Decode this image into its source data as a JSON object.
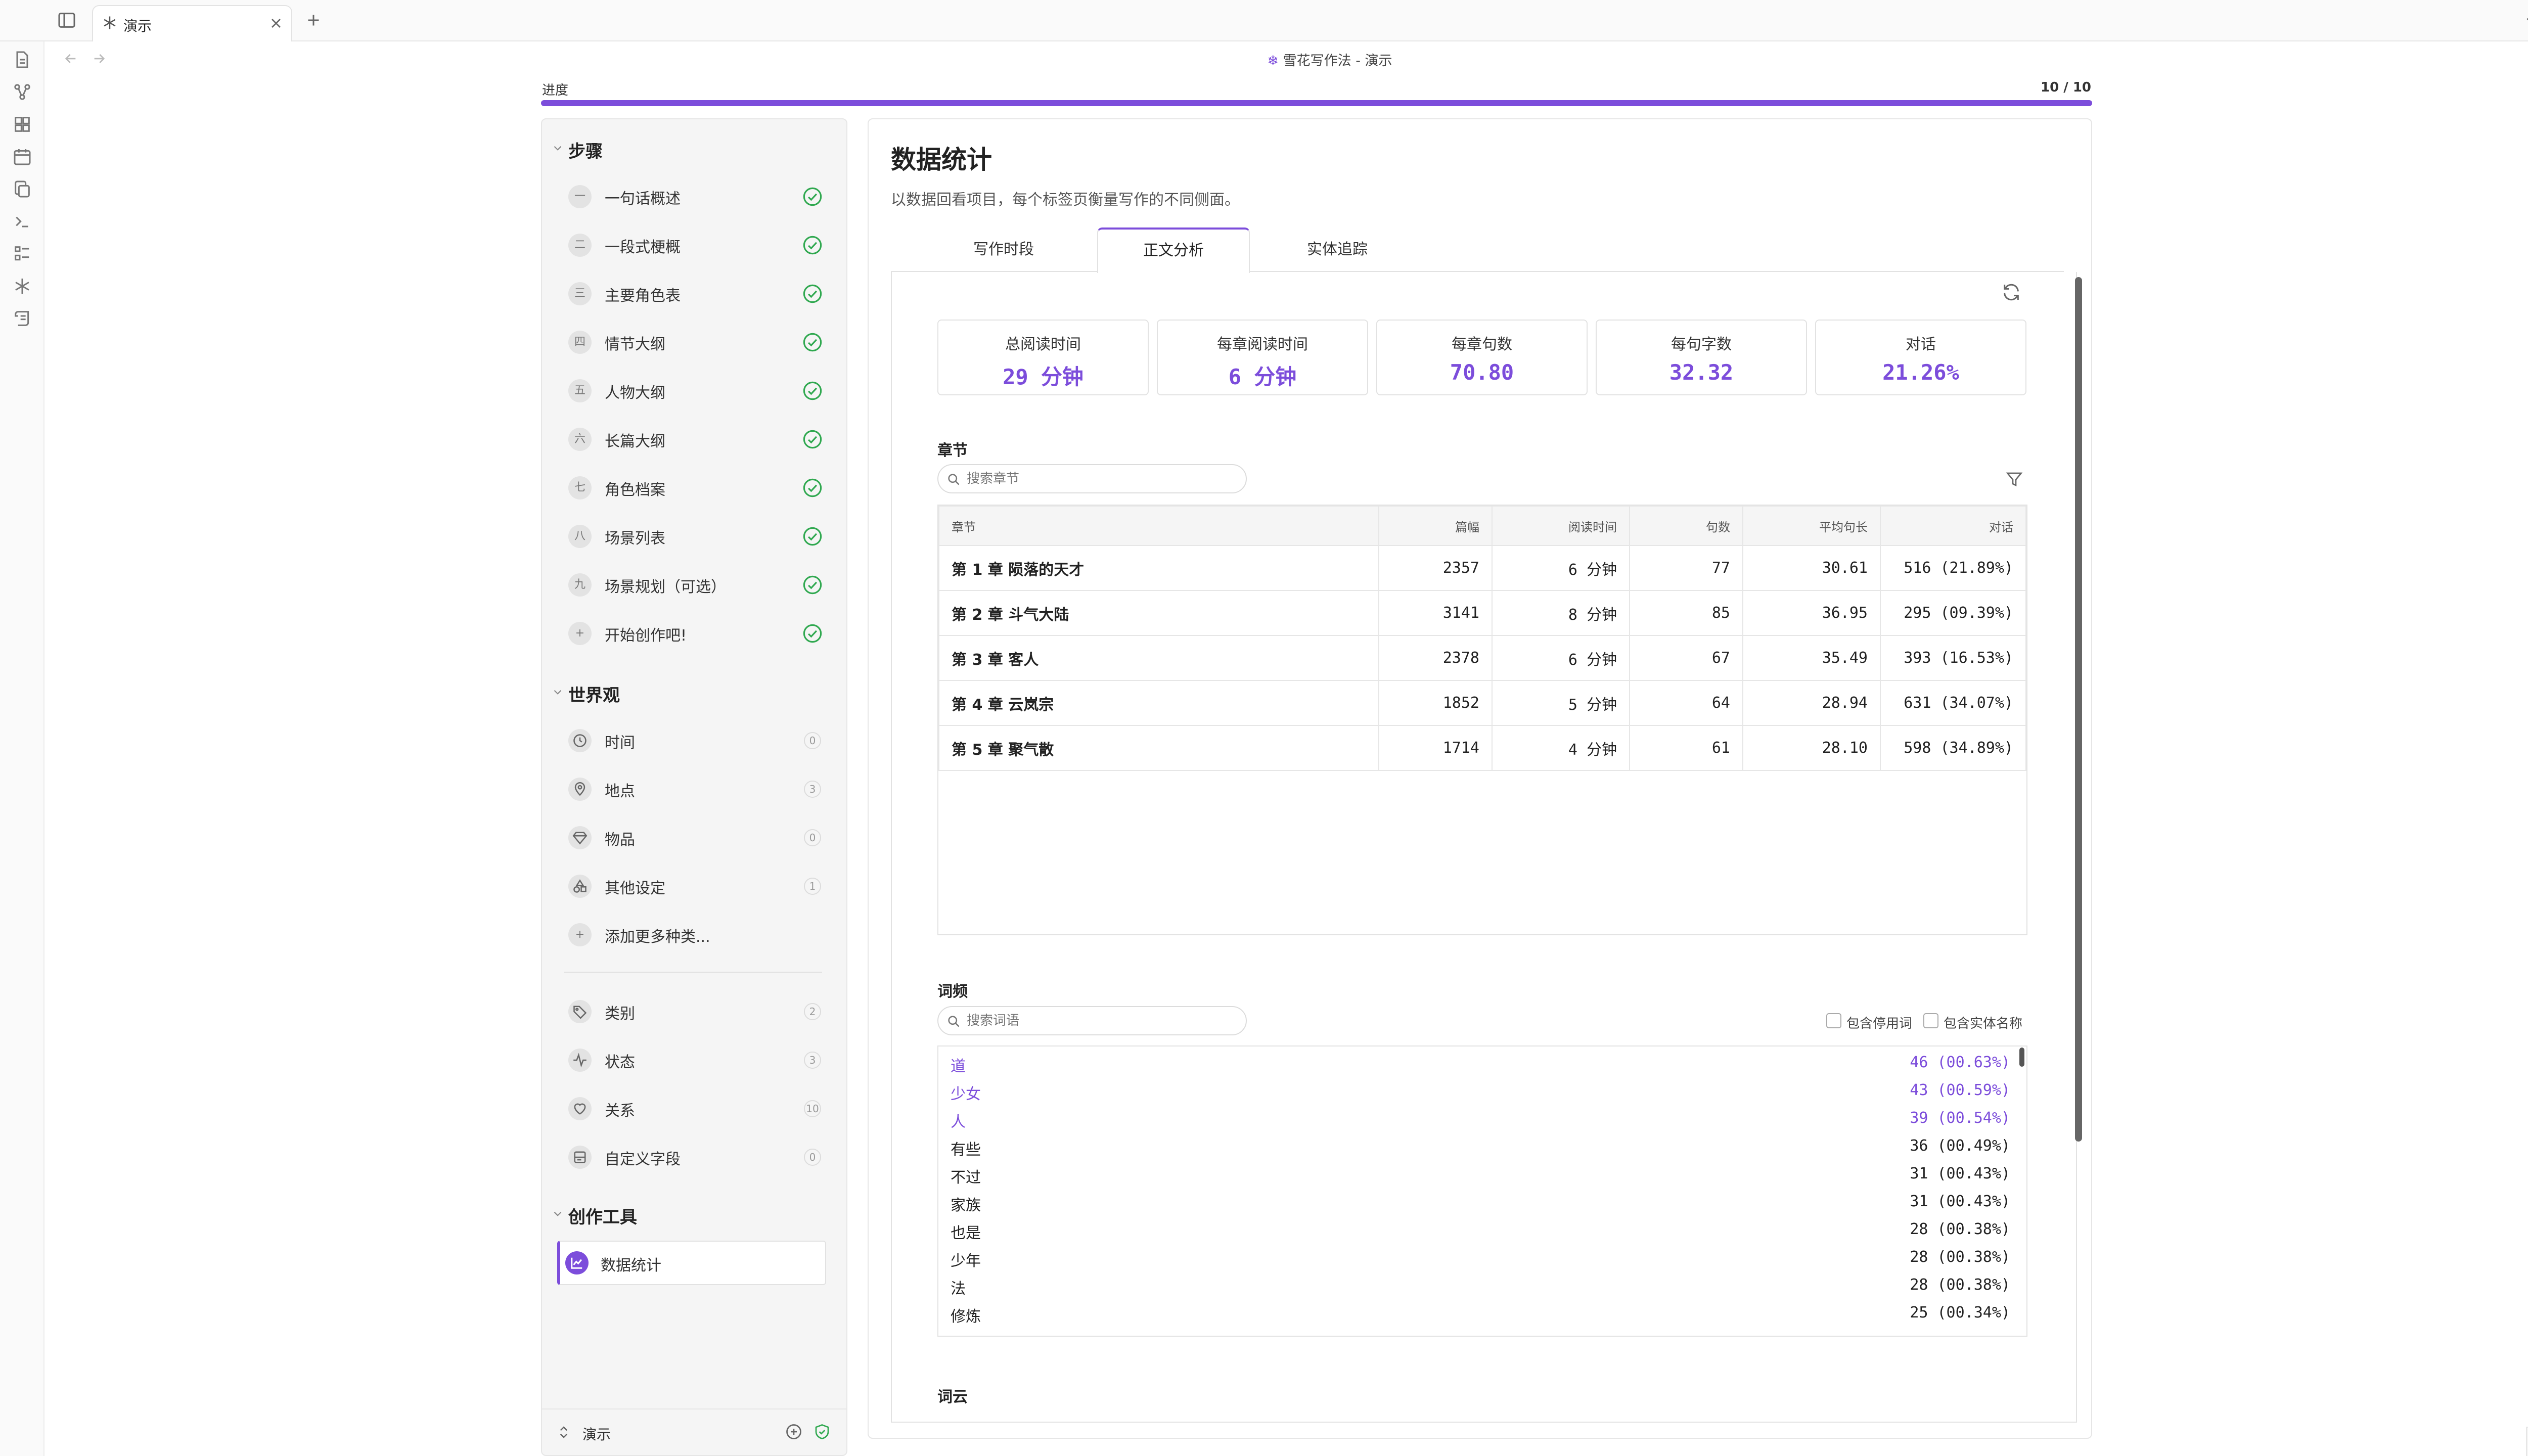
{
  "tab": {
    "title": "演示"
  },
  "header": {
    "title": "雪花写作法 - 演示"
  },
  "progress": {
    "label": "进度",
    "value": "10 / 10",
    "fraction": 1.0
  },
  "sidebar": {
    "steps_title": "步骤",
    "steps": [
      {
        "num": "一",
        "label": "一句话概述"
      },
      {
        "num": "二",
        "label": "一段式梗概"
      },
      {
        "num": "三",
        "label": "主要角色表"
      },
      {
        "num": "四",
        "label": "情节大纲"
      },
      {
        "num": "五",
        "label": "人物大纲"
      },
      {
        "num": "六",
        "label": "长篇大纲"
      },
      {
        "num": "七",
        "label": "角色档案"
      },
      {
        "num": "八",
        "label": "场景列表"
      },
      {
        "num": "九",
        "label": "场景规划（可选）"
      },
      {
        "num": "+",
        "label": "开始创作吧!"
      }
    ],
    "world_title": "世界观",
    "world": [
      {
        "icon": "clock-icon",
        "label": "时间",
        "count": "0"
      },
      {
        "icon": "map-pin-icon",
        "label": "地点",
        "count": "3"
      },
      {
        "icon": "gem-icon",
        "label": "物品",
        "count": "0"
      },
      {
        "icon": "shapes-icon",
        "label": "其他设定",
        "count": "1"
      },
      {
        "icon": "plus-icon",
        "label": "添加更多种类...",
        "count": ""
      }
    ],
    "meta": [
      {
        "icon": "tag-icon",
        "label": "类别",
        "count": "2"
      },
      {
        "icon": "activity-icon",
        "label": "状态",
        "count": "3"
      },
      {
        "icon": "heart-handshake-icon",
        "label": "关系",
        "count": "10"
      },
      {
        "icon": "form-icon",
        "label": "自定义字段",
        "count": "0"
      }
    ],
    "tools_title": "创作工具",
    "tools": [
      {
        "icon": "chart-icon",
        "label": "数据统计"
      }
    ],
    "footer_label": "演示"
  },
  "main": {
    "title": "数据统计",
    "subtitle": "以数据回看项目，每个标签页衡量写作的不同侧面。",
    "tabs": [
      "写作时段",
      "正文分析",
      "实体追踪"
    ],
    "active_tab": 1,
    "stats": [
      {
        "label": "总阅读时间",
        "value": "29 分钟"
      },
      {
        "label": "每章阅读时间",
        "value": "6 分钟"
      },
      {
        "label": "每章句数",
        "value": "70.80"
      },
      {
        "label": "每句字数",
        "value": "32.32"
      },
      {
        "label": "对话",
        "value": "21.26%"
      }
    ],
    "chapters": {
      "title": "章节",
      "search_placeholder": "搜索章节",
      "columns": [
        "章节",
        "篇幅",
        "阅读时间",
        "句数",
        "平均句长",
        "对话"
      ],
      "rows": [
        [
          "第 1 章 陨落的天才",
          "2357",
          "6 分钟",
          "77",
          "30.61",
          "516 (21.89%)"
        ],
        [
          "第 2 章 斗气大陆",
          "3141",
          "8 分钟",
          "85",
          "36.95",
          "295 (09.39%)"
        ],
        [
          "第 3 章 客人",
          "2378",
          "6 分钟",
          "67",
          "35.49",
          "393 (16.53%)"
        ],
        [
          "第 4 章 云岚宗",
          "1852",
          "5 分钟",
          "64",
          "28.94",
          "631 (34.07%)"
        ],
        [
          "第 5 章 聚气散",
          "1714",
          "4 分钟",
          "61",
          "28.10",
          "598 (34.89%)"
        ]
      ]
    },
    "words": {
      "title": "词频",
      "search_placeholder": "搜索词语",
      "opt_stopwords": "包含停用词",
      "opt_entities": "包含实体名称",
      "items": [
        {
          "word": "道",
          "value": "46 (00.63%)",
          "highlight": true
        },
        {
          "word": "少女",
          "value": "43 (00.59%)",
          "highlight": true
        },
        {
          "word": "人",
          "value": "39 (00.54%)",
          "highlight": true
        },
        {
          "word": "有些",
          "value": "36 (00.49%)",
          "highlight": false
        },
        {
          "word": "不过",
          "value": "31 (00.43%)",
          "highlight": false
        },
        {
          "word": "家族",
          "value": "31 (00.43%)",
          "highlight": false
        },
        {
          "word": "也是",
          "value": "28 (00.38%)",
          "highlight": false
        },
        {
          "word": "少年",
          "value": "28 (00.38%)",
          "highlight": false
        },
        {
          "word": "法",
          "value": "28 (00.38%)",
          "highlight": false
        },
        {
          "word": "修炼",
          "value": "25 (00.34%)",
          "highlight": false
        }
      ]
    },
    "cloud": {
      "title": "词云"
    }
  },
  "colors": {
    "accent": "#7c4ddb",
    "check": "#2fa84f"
  }
}
